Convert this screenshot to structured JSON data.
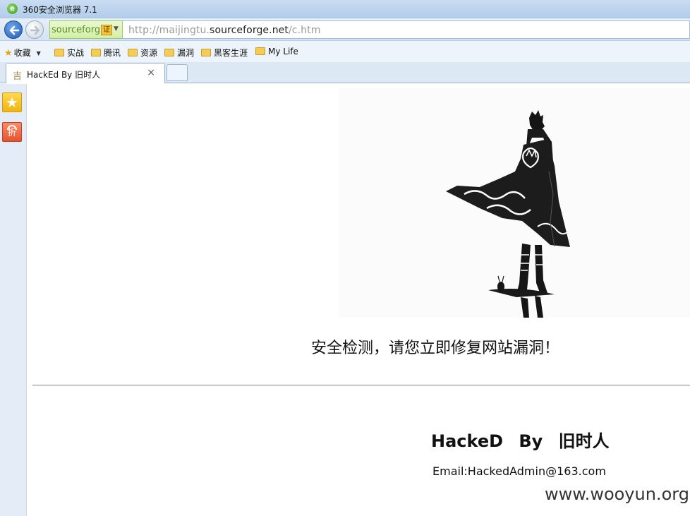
{
  "window": {
    "title": "360安全浏览器 7.1"
  },
  "address_bar": {
    "site_label": "sourceforg",
    "cert_label": "证",
    "url_prefix": "http://maijingtu.",
    "url_host": "sourceforge.net",
    "url_path": "/c.htm"
  },
  "favorites": {
    "label": "收藏",
    "items": [
      "实战",
      "腾讯",
      "资源",
      "漏洞",
      "黑客生涯",
      "My Life"
    ]
  },
  "tabs": [
    {
      "title": "HackEd By 旧时人"
    }
  ],
  "page": {
    "warning": "安全检测，请您立即修复网站漏洞！",
    "hacked_by": "HackeD   By   旧时人",
    "email": "Email:HackedAdmin@163.com",
    "watermark": "www.wooyun.org"
  },
  "side_panel": {
    "deal_label": "折"
  },
  "colors": {
    "accent": "#2a66c0",
    "cert_bg": "#f6c43b",
    "site_chip_bg": "#d3efa6"
  }
}
